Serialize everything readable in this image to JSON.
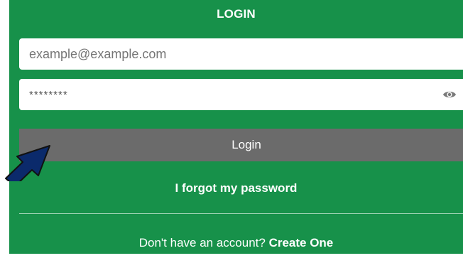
{
  "login": {
    "title": "LOGIN",
    "email_placeholder": "example@example.com",
    "password_value": "********",
    "submit_label": "Login",
    "forgot_label": "I forgot my password",
    "signup_prompt": "Don't have an account?",
    "signup_link": "Create One"
  },
  "icons": {
    "password_toggle": "eye-icon",
    "pointer": "arrow-icon"
  },
  "colors": {
    "panel_bg": "#17914a",
    "button_bg": "#6b6b6b",
    "arrow": "#0b2a6b"
  }
}
